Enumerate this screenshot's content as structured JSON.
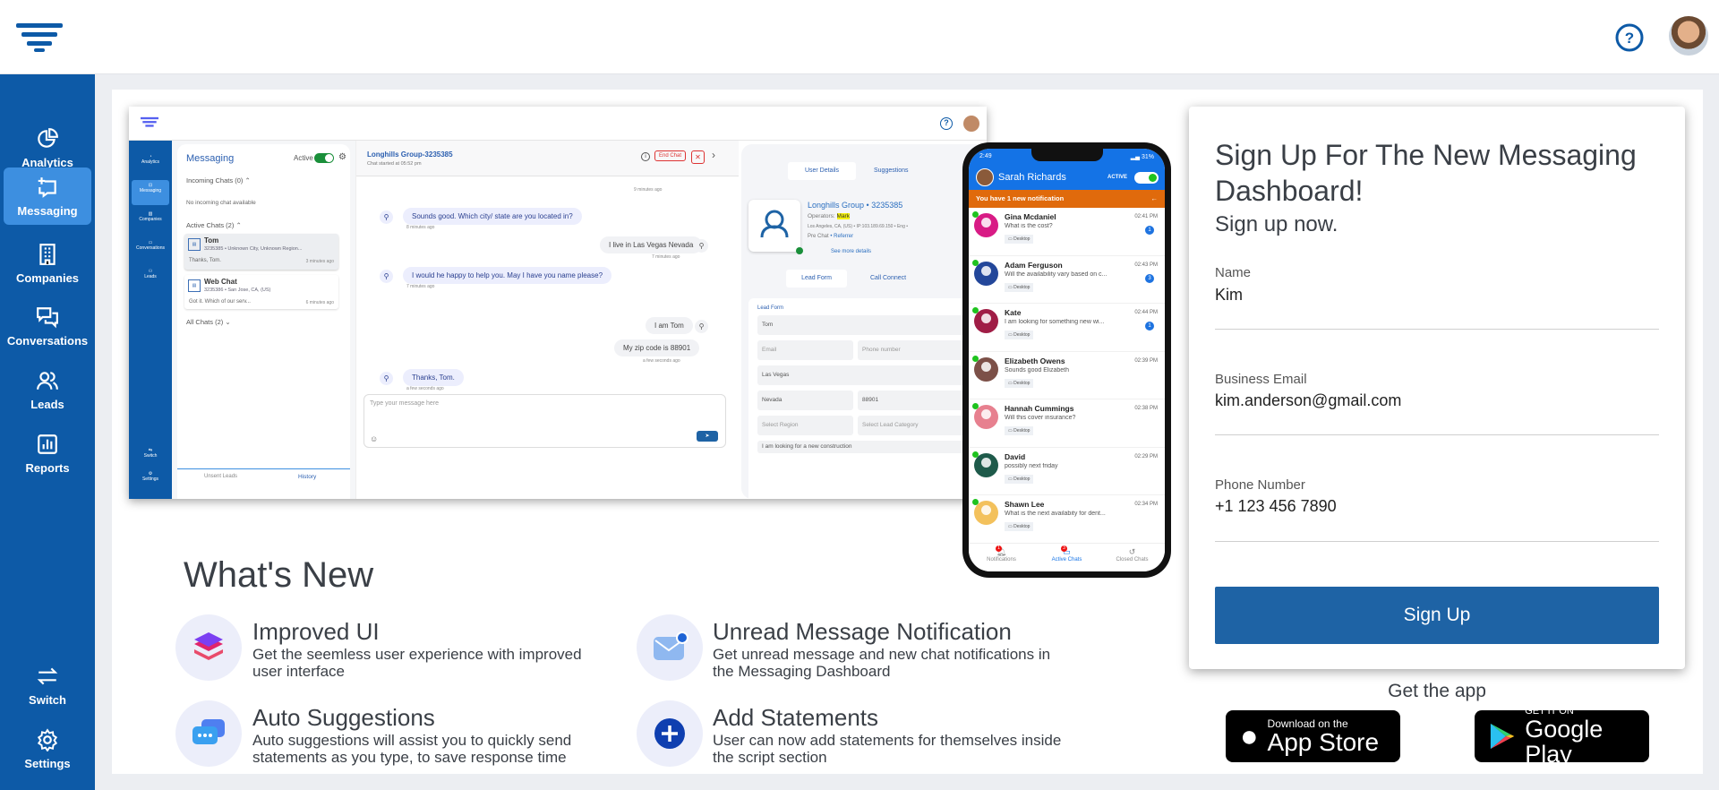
{
  "header": {
    "logo": "filter-logo",
    "help_icon": "question-circle-icon",
    "avatar": "user-avatar"
  },
  "sidebar": {
    "items": [
      {
        "label": "Analytics",
        "icon": "pie-chart-icon"
      },
      {
        "label": "Messaging",
        "icon": "message-icon",
        "active": true
      },
      {
        "label": "Companies",
        "icon": "building-icon"
      },
      {
        "label": "Conversations",
        "icon": "chat-bubbles-icon"
      },
      {
        "label": "Leads",
        "icon": "users-icon"
      },
      {
        "label": "Reports",
        "icon": "bar-chart-icon"
      },
      {
        "label": "Switch",
        "icon": "switch-arrows-icon"
      },
      {
        "label": "Settings",
        "icon": "gear-icon"
      }
    ]
  },
  "mock": {
    "sidebar": [
      "Analytics",
      "Messaging",
      "Companies",
      "Conversations",
      "Leads",
      "Switch",
      "Settings"
    ],
    "list": {
      "title": "Messaging",
      "active_label": "Active",
      "incoming": "Incoming Chats (0)",
      "no_incoming": "No incoming chat available",
      "active_chats": "Active Chats (2)",
      "all_chats": "All Chats (2)",
      "chats": [
        {
          "name": "Tom",
          "meta": "3235385 • Unknown City, Unknown Region...",
          "last": "Thanks, Tom.",
          "time": "3 minutes ago"
        },
        {
          "name": "Web Chat",
          "meta": "3235386 • San Jose, CA, (US)",
          "last": "Got it. Which of our serv...",
          "time": "6 minutes ago"
        }
      ],
      "bottom_tabs": [
        "Unsent Leads",
        "History"
      ]
    },
    "chat": {
      "title": "Longhills Group-3235385",
      "subtitle": "Chat started at 05:52 pm",
      "end_chat": "End Chat",
      "placeholder": "Type your message here",
      "messages": [
        {
          "text": "",
          "time": "9 minutes ago",
          "dir": "out"
        },
        {
          "text": "Sounds good. Which city/ state are you located in?",
          "time": "8 minutes ago",
          "dir": "in"
        },
        {
          "text": "I live in Las Vegas Nevada",
          "time": "7 minutes ago",
          "dir": "out"
        },
        {
          "text": "I would he happy to help you. May I have you name please?",
          "time": "7 minutes ago",
          "dir": "in"
        },
        {
          "text": "I am Tom",
          "time": "",
          "dir": "out"
        },
        {
          "text": "My zip code is 88901",
          "time": "a few seconds ago",
          "dir": "out"
        },
        {
          "text": "Thanks, Tom.",
          "time": "a few seconds ago",
          "dir": "in"
        }
      ]
    },
    "details": {
      "tabs": [
        "User Details",
        "Suggestions"
      ],
      "company": "Longhills Group • 3235385",
      "operators_label": "Operators:",
      "operator": "Mark",
      "location": "Los Angeles, CA, (US) • IP:103.189.69.150 • Eng •",
      "prechat": "Pre Chat",
      "referrer": "• Referrer",
      "see_more": "See more details",
      "form_tabs": [
        "Lead Form",
        "Call Connect"
      ],
      "form_title": "Lead Form",
      "fields": {
        "name": "Tom",
        "email": "Email",
        "phone": "Phone number",
        "city": "Las Vegas",
        "state": "Nevada",
        "zip": "88901",
        "region": "Select Region",
        "category": "Select Lead Category",
        "notes": "I am looking for a new construction"
      }
    }
  },
  "phone": {
    "time": "2:49",
    "battery": "31%",
    "user": "Sarah Richards",
    "status": "ACTIVE",
    "notification": "You have 1 new notification",
    "chats": [
      {
        "name": "Gina Mcdaniel",
        "msg": "What is the cost?",
        "time": "02:41 PM",
        "badge": "1",
        "color": "#d81b85"
      },
      {
        "name": "Adam Ferguson",
        "msg": "Will the availability vary based on c...",
        "time": "02:43 PM",
        "badge": "3",
        "color": "#23479a"
      },
      {
        "name": "Kate",
        "msg": "I am looking for something new wi...",
        "time": "02:44 PM",
        "badge": "1",
        "color": "#a01d46"
      },
      {
        "name": "Elizabeth Owens",
        "msg": "Sounds good Elizabeth",
        "time": "02:39 PM",
        "badge": "",
        "color": "#7c5048"
      },
      {
        "name": "Hannah Cummings",
        "msg": "Will this cover insurance?",
        "time": "02:38 PM",
        "badge": "",
        "color": "#e7808f"
      },
      {
        "name": "David",
        "msg": "possibly next friday",
        "time": "02:29 PM",
        "badge": "",
        "color": "#1e5a4a"
      },
      {
        "name": "Shawn Lee",
        "msg": "What is the next availabity for dent...",
        "time": "02:34 PM",
        "badge": "",
        "color": "#f3c15c"
      }
    ],
    "device": "Desktop",
    "tabs": [
      {
        "label": "Notifications",
        "badge": "1"
      },
      {
        "label": "Active Chats",
        "badge": "3"
      },
      {
        "label": "Closed Chats",
        "badge": ""
      }
    ]
  },
  "whats_new": {
    "title": "What's New",
    "features": [
      {
        "title": "Improved UI",
        "desc": "Get the seemless user experience with improved user interface",
        "icon": "layers-icon"
      },
      {
        "title": "Unread Message Notification",
        "desc": "Get unread message and new chat notifications in the Messaging Dashboard",
        "icon": "mail-notification-icon"
      },
      {
        "title": "Auto Suggestions",
        "desc": "Auto suggestions will assist you to quickly send statements as you type, to save response time",
        "icon": "chat-suggestions-icon"
      },
      {
        "title": "Add Statements",
        "desc": "User can now add statements for themselves inside the script section",
        "icon": "plus-circle-icon"
      }
    ]
  },
  "signup": {
    "title": "Sign Up For The New Messaging Dashboard!",
    "subtitle": "Sign up now.",
    "fields": [
      {
        "label": "Name",
        "value": "Kim"
      },
      {
        "label": "Business Email",
        "value": "kim.anderson@gmail.com"
      },
      {
        "label": "Phone Number",
        "value": "+1 123 456 7890"
      }
    ],
    "button": "Sign Up",
    "button_color": "#1e63a5"
  },
  "app": {
    "title": "Get the app",
    "appstore_small": "Download on the",
    "appstore_big": "App Store",
    "play_small": "GET IT ON",
    "play_big": "Google Play"
  }
}
